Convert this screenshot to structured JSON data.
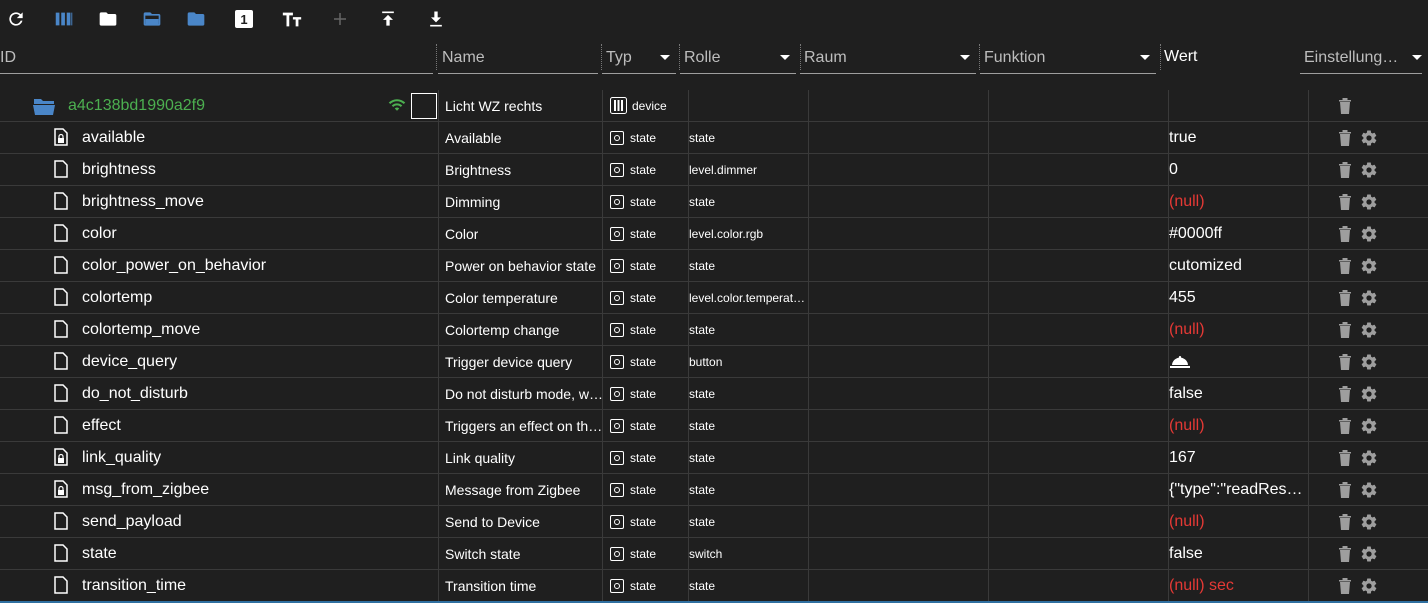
{
  "toolbar": {
    "buttons": [
      {
        "icon": "refresh-icon"
      },
      {
        "icon": "columns-icon"
      },
      {
        "icon": "folder-icon"
      },
      {
        "icon": "folder-open-icon"
      },
      {
        "icon": "folder-blue-icon"
      },
      {
        "icon": "one-box-icon",
        "text": "1"
      },
      {
        "icon": "text-size-icon"
      },
      {
        "icon": "plus-icon"
      },
      {
        "icon": "upload-icon"
      },
      {
        "icon": "download-icon"
      }
    ]
  },
  "columns": {
    "id": "ID",
    "name": "Name",
    "type": "Typ",
    "role": "Rolle",
    "room": "Raum",
    "function": "Funktion",
    "value": "Wert",
    "settings": "Einstellung…"
  },
  "device": {
    "id": "a4c138bd1990a2f9",
    "name": "Licht WZ rechts",
    "type": "device",
    "id_color": "#4caf50",
    "folder_color": "#4a86c8"
  },
  "rows": [
    {
      "id": "available",
      "name": "Available",
      "type": "state",
      "role": "state",
      "value": "true",
      "null": false,
      "locked": true
    },
    {
      "id": "brightness",
      "name": "Brightness",
      "type": "state",
      "role": "level.dimmer",
      "value": "0",
      "null": false,
      "locked": false
    },
    {
      "id": "brightness_move",
      "name": "Dimming",
      "type": "state",
      "role": "state",
      "value": "(null)",
      "null": true,
      "locked": false
    },
    {
      "id": "color",
      "name": "Color",
      "type": "state",
      "role": "level.color.rgb",
      "value": "#0000ff",
      "null": false,
      "locked": false
    },
    {
      "id": "color_power_on_behavior",
      "name": "Power on behavior state",
      "type": "state",
      "role": "state",
      "value": "cutomized",
      "null": false,
      "locked": false
    },
    {
      "id": "colortemp",
      "name": "Color temperature",
      "type": "state",
      "role": "level.color.temperat…",
      "value": "455",
      "null": false,
      "locked": false
    },
    {
      "id": "colortemp_move",
      "name": "Colortemp change",
      "type": "state",
      "role": "state",
      "value": "(null)",
      "null": true,
      "locked": false
    },
    {
      "id": "device_query",
      "name": "Trigger device query",
      "type": "state",
      "role": "button",
      "value": "",
      "null": false,
      "locked": false,
      "bell": true
    },
    {
      "id": "do_not_disturb",
      "name": "Do not disturb mode, w…",
      "type": "state",
      "role": "state",
      "value": "false",
      "null": false,
      "locked": false
    },
    {
      "id": "effect",
      "name": "Triggers an effect on th…",
      "type": "state",
      "role": "state",
      "value": "(null)",
      "null": true,
      "locked": false
    },
    {
      "id": "link_quality",
      "name": "Link quality",
      "type": "state",
      "role": "state",
      "value": "167",
      "null": false,
      "locked": true
    },
    {
      "id": "msg_from_zigbee",
      "name": "Message from Zigbee",
      "type": "state",
      "role": "state",
      "value": "{\"type\":\"readRes…",
      "null": false,
      "locked": true
    },
    {
      "id": "send_payload",
      "name": "Send to Device",
      "type": "state",
      "role": "state",
      "value": "(null)",
      "null": true,
      "locked": false
    },
    {
      "id": "state",
      "name": "Switch state",
      "type": "state",
      "role": "switch",
      "value": "false",
      "null": false,
      "locked": false
    },
    {
      "id": "transition_time",
      "name": "Transition time",
      "type": "state",
      "role": "state",
      "value": "(null) sec",
      "null": true,
      "locked": false
    }
  ],
  "colors": {
    "background": "#1f1f1f",
    "accent_blue": "#4a86c8",
    "null_red": "#e53935",
    "device_green": "#4caf50",
    "icon_grey": "#9e9e9e"
  }
}
